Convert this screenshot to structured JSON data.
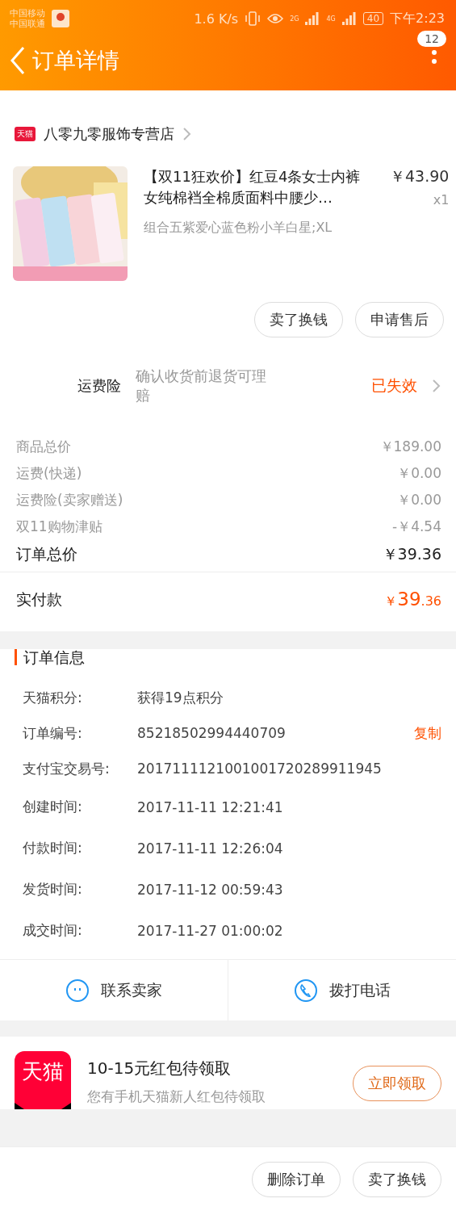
{
  "status_bar": {
    "carriers": [
      "中国移动",
      "中国联通"
    ],
    "speed": "1.6 K/s",
    "networks": [
      "2G",
      "4G"
    ],
    "battery": "40",
    "time": "下午2:23"
  },
  "header": {
    "title": "订单详情",
    "badge": "12"
  },
  "store": {
    "badge": "天猫",
    "name": "八零九零服饰专营店"
  },
  "product": {
    "title": "【双11狂欢价】红豆4条女士内裤女纯棉裆全棉质面料中腰少…",
    "sku": "组合五紫爱心蓝色粉小羊白星;XL",
    "price": "￥43.90",
    "qty": "x1"
  },
  "item_buttons": [
    "卖了换钱",
    "申请售后"
  ],
  "insurance": {
    "label": "运费险",
    "desc": "确认收货前退货可理赔",
    "status": "已失效"
  },
  "price_rows": [
    {
      "label": "商品总价",
      "value": "￥189.00"
    },
    {
      "label": "运费(快递)",
      "value": "￥0.00"
    },
    {
      "label": "运费险(卖家赠送)",
      "value": "￥0.00"
    },
    {
      "label": "双11购物津贴",
      "value": "-￥4.54"
    }
  ],
  "total": {
    "label": "订单总价",
    "value": "￥39.36"
  },
  "paid": {
    "label": "实付款",
    "currency": "￥",
    "integer": "39",
    "decimal": ".36"
  },
  "order_info": {
    "title": "订单信息",
    "rows": [
      {
        "label": "天猫积分:",
        "value": "获得19点积分"
      },
      {
        "label": "订单编号:",
        "value": "85218502994440709",
        "action": "复制"
      },
      {
        "label": "支付宝交易号:",
        "value": "2017111121001001720289911945"
      },
      {
        "label": "创建时间:",
        "value": "2017-11-11 12:21:41"
      },
      {
        "label": "付款时间:",
        "value": "2017-11-11 12:26:04"
      },
      {
        "label": "发货时间:",
        "value": "2017-11-12 00:59:43"
      },
      {
        "label": "成交时间:",
        "value": "2017-11-27 01:00:02"
      }
    ]
  },
  "contact": [
    {
      "kind": "chat",
      "label": "联系卖家"
    },
    {
      "kind": "phone",
      "label": "拨打电话"
    }
  ],
  "promo": {
    "logo": "天猫",
    "title": "10-15元红包待领取",
    "subtitle": "您有手机天猫新人红包待领取",
    "button": "立即领取"
  },
  "bottom_buttons": [
    "删除订单",
    "卖了换钱"
  ]
}
